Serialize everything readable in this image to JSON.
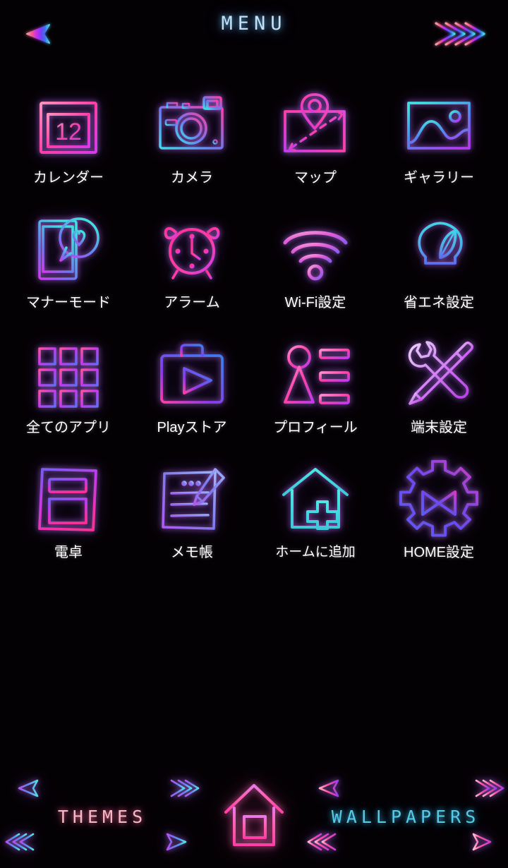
{
  "header": {
    "title": "MENU",
    "arrow_icon": "double-ended-arrow-icon"
  },
  "colors": {
    "background": "#040104",
    "label_text": "#ffffff",
    "menu_title": "#bfe2f5",
    "themes_text": "#f9b7c4",
    "wallpapers_text": "#57c9e8",
    "gradient_pink": "#ff3ea5",
    "gradient_magenta": "#c43bf0",
    "gradient_violet": "#6a4bff",
    "gradient_blue": "#3a7bff",
    "gradient_cyan": "#3fe0e0"
  },
  "grid": {
    "columns": 4,
    "rows": 4,
    "items": [
      {
        "label": "カレンダー",
        "icon": "calendar-icon",
        "name": "calendar",
        "badge": "12"
      },
      {
        "label": "カメラ",
        "icon": "camera-icon",
        "name": "camera",
        "badge": ""
      },
      {
        "label": "マップ",
        "icon": "map-pin-icon",
        "name": "map",
        "badge": ""
      },
      {
        "label": "ギャラリー",
        "icon": "gallery-image-icon",
        "name": "gallery",
        "badge": ""
      },
      {
        "label": "マナーモード",
        "icon": "phone-heart-icon",
        "name": "manner-mode",
        "badge": ""
      },
      {
        "label": "アラーム",
        "icon": "alarm-clock-icon",
        "name": "alarm",
        "badge": ""
      },
      {
        "label": "Wi-Fi設定",
        "icon": "wifi-icon",
        "name": "wifi-settings",
        "badge": ""
      },
      {
        "label": "省エネ設定",
        "icon": "eco-bulb-icon",
        "name": "eco-settings",
        "badge": ""
      },
      {
        "label": "全てのアプリ",
        "icon": "app-grid-icon",
        "name": "all-apps",
        "badge": ""
      },
      {
        "label": "Playストア",
        "icon": "play-store-icon",
        "name": "play-store",
        "badge": ""
      },
      {
        "label": "プロフィール",
        "icon": "profile-icon",
        "name": "profile",
        "badge": ""
      },
      {
        "label": "端末設定",
        "icon": "tools-icon",
        "name": "device-settings",
        "badge": ""
      },
      {
        "label": "電卓",
        "icon": "calculator-icon",
        "name": "calculator",
        "badge": ""
      },
      {
        "label": "メモ帳",
        "icon": "memo-pencil-icon",
        "name": "memo-pad",
        "badge": ""
      },
      {
        "label": "ホームに追加",
        "icon": "house-plus-icon",
        "name": "add-to-home",
        "badge": ""
      },
      {
        "label": "HOME設定",
        "icon": "gear-icon",
        "name": "home-settings",
        "badge": ""
      }
    ]
  },
  "bottom_nav": {
    "themes": {
      "label": "THEMES",
      "top_arrow_icon": "arrow-left-icon",
      "bottom_arrow_icon": "arrow-right-icon"
    },
    "home": {
      "label": "",
      "icon": "home-house-icon"
    },
    "wallpapers": {
      "label": "WALLPAPERS",
      "top_arrow_icon": "arrow-left-icon",
      "bottom_arrow_icon": "arrow-right-icon"
    }
  }
}
